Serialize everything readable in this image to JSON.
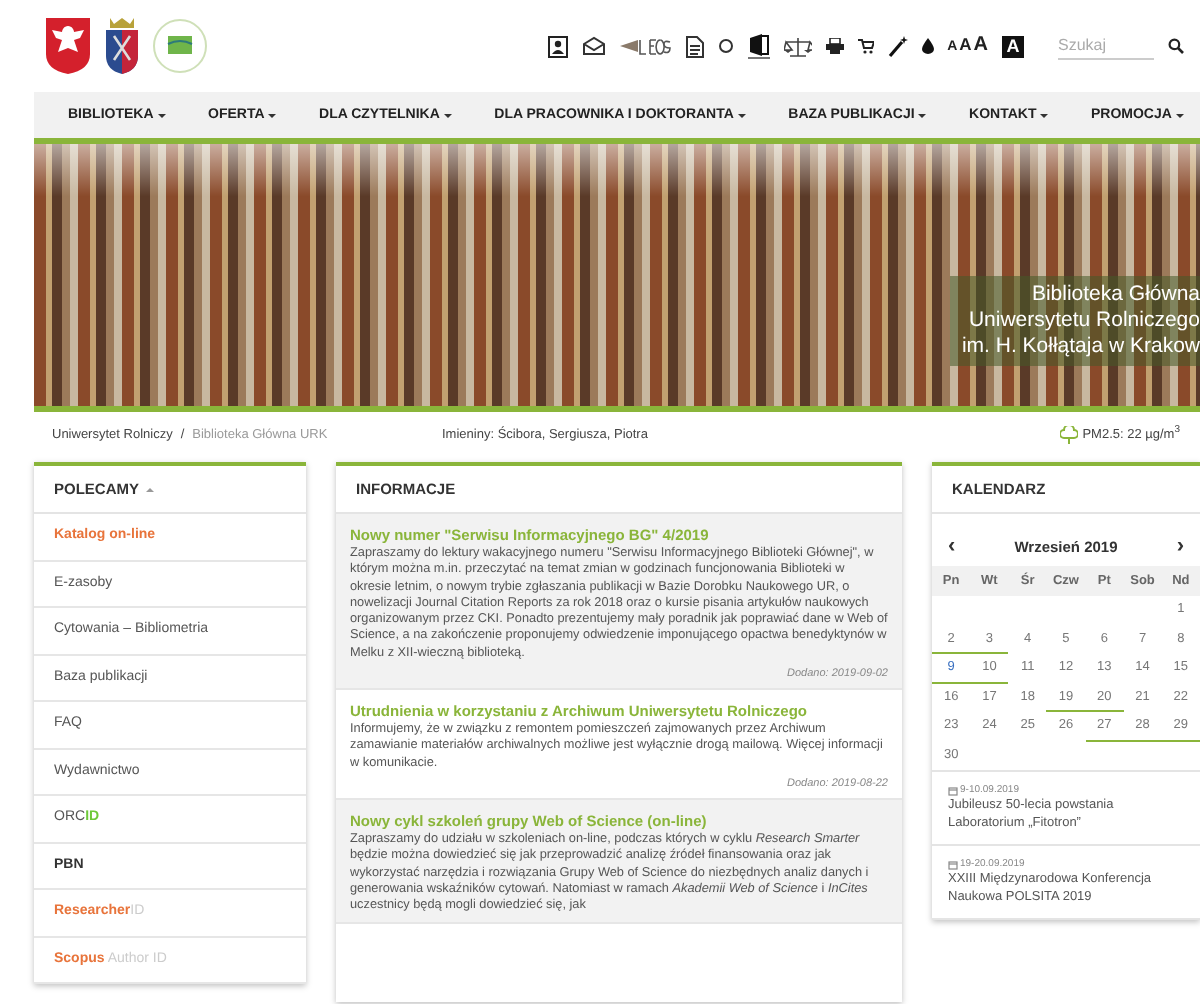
{
  "toolbar": {
    "font_sizes": [
      "A",
      "A",
      "A"
    ],
    "contrast": "A",
    "search": {
      "placeholder": "Szukaj"
    }
  },
  "nav": [
    {
      "label": "BIBLIOTEKA"
    },
    {
      "label": "OFERTA"
    },
    {
      "label": "DLA CZYTELNIKA"
    },
    {
      "label": "DLA PRACOWNIKA I DOKTORANTA"
    },
    {
      "label": "BAZA PUBLIKACJI"
    },
    {
      "label": "KONTAKT"
    },
    {
      "label": "PROMOCJA"
    }
  ],
  "banner": {
    "lines": [
      "Biblioteka Główna",
      "Uniwersytetu Rolniczego",
      "im. H. Kołłątaja w Krakow"
    ]
  },
  "breadcrumb": {
    "separator": "/",
    "items": [
      {
        "label": "Uniwersytet Rolniczy",
        "current": false
      },
      {
        "label": "Biblioteka Główna URK",
        "current": true
      }
    ]
  },
  "namedays": "Imieniny: Ścibora, Sergiusza, Piotra",
  "air_quality": "PM2.5: 22 µg/m$^{3}$",
  "sidebar": {
    "title": "POLECAMY",
    "expanded": true,
    "items": [
      {
        "parts": [
          {
            "text": "Katalog on-line",
            "kind": "accent"
          }
        ]
      },
      {
        "parts": [
          {
            "text": "E-zasoby",
            "kind": "plain"
          }
        ]
      },
      {
        "parts": [
          {
            "text": "Cytowania – Bibliometria",
            "kind": "plain"
          }
        ]
      },
      {
        "parts": [
          {
            "text": "Baza publikacji",
            "kind": "plain"
          }
        ]
      },
      {
        "parts": [
          {
            "text": "FAQ",
            "kind": "plain"
          }
        ]
      },
      {
        "parts": [
          {
            "text": "Wydawnictwo",
            "kind": "plain"
          }
        ]
      },
      {
        "parts": [
          {
            "text": "ORC",
            "kind": "plain"
          },
          {
            "text": "ID",
            "kind": "green"
          }
        ]
      },
      {
        "parts": [
          {
            "text": "PBN",
            "kind": "strong"
          }
        ]
      },
      {
        "parts": [
          {
            "text": "Researcher",
            "kind": "accent"
          },
          {
            "text": "ID",
            "kind": "muted"
          }
        ]
      },
      {
        "parts": [
          {
            "text": "Scopus",
            "kind": "accent"
          },
          {
            "text": " Author ID",
            "kind": "muted"
          }
        ]
      }
    ]
  },
  "news": {
    "title": "INFORMACJE",
    "items": [
      {
        "title": "Nowy numer \"Serwisu Informacyjnego BG\" 4/2019",
        "body": "Zapraszamy do lektury wakacyjnego numeru \"Serwisu Informacyjnego Biblioteki Głównej\", w którym można m.in. przeczytać na temat zmian w godzinach funcjonowania Biblioteki w okresie letnim, o nowym trybie zgłaszania publikacji w Bazie Dorobku Naukowego UR, o nowelizacji Journal Citation Reports za rok 2018 oraz o kursie pisania artykułów naukowych organizowanym przez CKI. Ponadto prezentujemy mały poradnik jak poprawiać dane w Web of Science, a na zakończenie proponujemy odwiedzenie imponującego opactwa benedyktynów w Melku z XII-wieczną biblioteką.",
        "date": "Dodano: 2019-09-02"
      },
      {
        "title": "Utrudnienia w korzystaniu z Archiwum Uniwersytetu Rolniczego",
        "body": "Informujemy, że w związku z remontem pomieszczeń zajmowanych przez Archiwum zamawianie materiałów archiwalnych możliwe jest wyłącznie drogą mailową. Więcej informacji w komunikacie.",
        "date": "Dodano: 2019-08-22"
      },
      {
        "title": "Nowy cykl szkoleń grupy Web of Science (on-line)",
        "body": "Zapraszamy do udziału w szkoleniach on-line, podczas których w cyklu *Research Smarter* będzie można dowiedzieć się jak przeprowadzić analizę źródeł finansowania oraz jak wykorzystać narzędzia i rozwiązania Grupy Web of Science do niezbędnych analiz danych i generowania wskaźników cytowań. Natomiast w ramach *Akademii Web of Science* i *InCites* uczestnicy będą mogli dowiedzieć się, jak"
      }
    ]
  },
  "calendar": {
    "title": "KALENDARZ",
    "prev": "‹",
    "next": "›",
    "month": "Wrzesień 2019",
    "weekdays": [
      "Pn",
      "Wt",
      "Śr",
      "Czw",
      "Pt",
      "Sob",
      "Nd"
    ],
    "weeks": [
      {
        "kind": "end",
        "days": [
          {
            "day": "1",
            "event": false,
            "today": false
          }
        ]
      },
      {
        "kind": "start",
        "days": [
          {
            "day": "2",
            "event": true,
            "today": false
          },
          {
            "day": "3",
            "event": true,
            "today": false
          },
          {
            "day": "4",
            "event": false,
            "today": false
          },
          {
            "day": "5",
            "event": false,
            "today": false
          },
          {
            "day": "6",
            "event": false,
            "today": false
          },
          {
            "day": "7",
            "event": false,
            "today": false
          },
          {
            "day": "8",
            "event": false,
            "today": false
          }
        ]
      },
      {
        "kind": "start",
        "days": [
          {
            "day": "9",
            "event": true,
            "today": true
          },
          {
            "day": "10",
            "event": true,
            "today": false
          },
          {
            "day": "11",
            "event": false,
            "today": false
          },
          {
            "day": "12",
            "event": false,
            "today": false
          },
          {
            "day": "13",
            "event": false,
            "today": false
          },
          {
            "day": "14",
            "event": false,
            "today": false
          },
          {
            "day": "15",
            "event": false,
            "today": false
          }
        ]
      },
      {
        "kind": "start",
        "days": [
          {
            "day": "16",
            "event": false,
            "today": false
          },
          {
            "day": "17",
            "event": false,
            "today": false
          },
          {
            "day": "18",
            "event": false,
            "today": false
          },
          {
            "day": "19",
            "event": true,
            "today": false
          },
          {
            "day": "20",
            "event": true,
            "today": false
          },
          {
            "day": "21",
            "event": false,
            "today": false
          },
          {
            "day": "22",
            "event": false,
            "today": false
          }
        ]
      },
      {
        "kind": "start",
        "days": [
          {
            "day": "23",
            "event": false,
            "today": false
          },
          {
            "day": "24",
            "event": false,
            "today": false
          },
          {
            "day": "25",
            "event": false,
            "today": false
          },
          {
            "day": "26",
            "event": false,
            "today": false
          },
          {
            "day": "27",
            "event": true,
            "today": false
          },
          {
            "day": "28",
            "event": true,
            "today": false
          },
          {
            "day": "29",
            "event": true,
            "today": false
          }
        ]
      },
      {
        "kind": "start",
        "days": [
          {
            "day": "30",
            "event": false,
            "today": false
          }
        ]
      }
    ],
    "events": [
      {
        "date": "9-10.09.2019",
        "title": "Jubileusz 50-lecia powstania Laboratorium „Fitotron”"
      },
      {
        "date": "19-20.09.2019",
        "title": "XXIII Międzynarodowa Konferencja Naukowa POLSITA 2019"
      }
    ]
  }
}
